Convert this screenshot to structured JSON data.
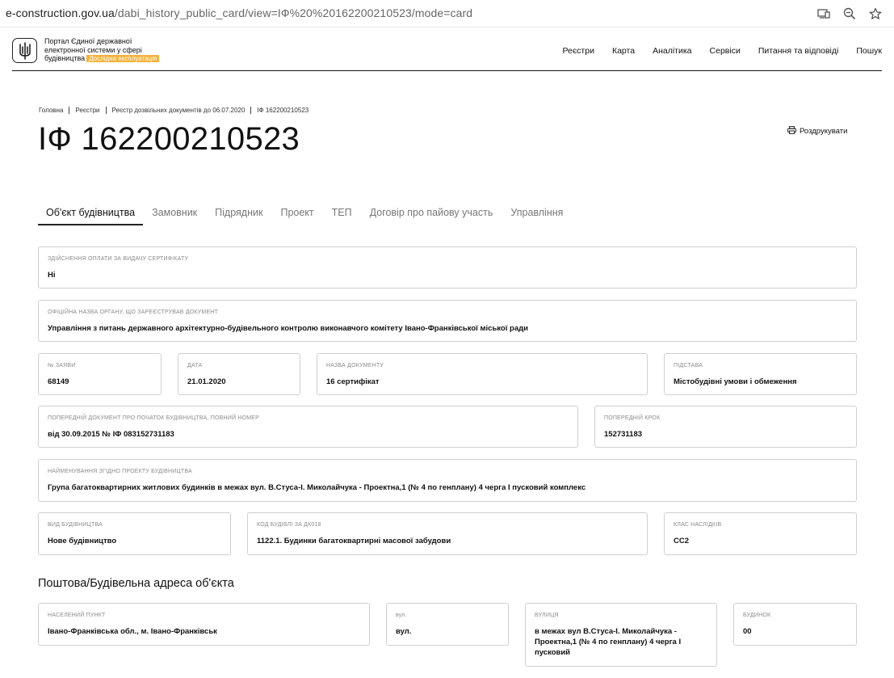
{
  "browser": {
    "url_host": "e-construction.gov.ua",
    "url_path": "/dabi_history_public_card/view=IФ%20%20162200210523/mode=card"
  },
  "header": {
    "logo_line1": "Портал Єдиної державної",
    "logo_line2": "електронної системи у сфері",
    "logo_line3": "будівництва",
    "logo_badge": "Дослідна експлуатація",
    "nav": [
      "Реєстри",
      "Карта",
      "Аналітика",
      "Сервіси",
      "Питання та відповіді",
      "Пошук"
    ]
  },
  "breadcrumb": [
    "Головна",
    "Реєстри",
    "Реєстр дозвільних документів до 06.07.2020",
    "ІФ 162200210523"
  ],
  "page_title": "ІФ 162200210523",
  "print_label": "Роздрукувати",
  "tabs": [
    "Об'єкт будівництва",
    "Замовник",
    "Підрядник",
    "Проект",
    "ТЕП",
    "Договір про пайову участь",
    "Управління"
  ],
  "fields": {
    "payment": {
      "label": "Здійснення оплати за видачу сертифікату",
      "value": "Ні"
    },
    "authority": {
      "label": "Офіційна назва органу, що зареєстрував документ",
      "value": "Управління з питань державного архітектурно-будівельного контролю виконавчого комітету Івано-Франківської міської ради"
    },
    "app_no": {
      "label": "№ заяви",
      "value": "68149"
    },
    "date": {
      "label": "Дата",
      "value": "21.01.2020"
    },
    "doc_name": {
      "label": "Назва документу",
      "value": "16 сертифікат"
    },
    "basis": {
      "label": "Підстава",
      "value": "Містобудівні умови і обмеження"
    },
    "prev_doc": {
      "label": "Попередній документ про початок будівництва, повний номер",
      "value": "від 30.09.2015 № ІФ 083152731183"
    },
    "prev_step": {
      "label": "Попередній крок",
      "value": "152731183"
    },
    "project_name": {
      "label": "Найменування згідно проекту будівництва",
      "value": "Група багатоквартирних житлових будинків в межах вул. В.Стуса-І. Миколайчука - Проектна,1 (№ 4 по генплану) 4 черга І пусковий комплекс"
    },
    "build_type": {
      "label": "Вид будівництва",
      "value": "Нове будівництво"
    },
    "building_code": {
      "label": "Код будівлі за ДК018",
      "value": "1122.1. Будинки багатоквартирні масової забудови"
    },
    "consequence_class": {
      "label": "Клас наслідків",
      "value": "СС2"
    }
  },
  "address_section_title": "Поштова/Будівельна адреса об'єкта",
  "address": {
    "settlement": {
      "label": "Населений пункт",
      "value": "Івано-Франківська обл., м. Івано-Франківськ"
    },
    "street_type": {
      "label": "вул.",
      "value": "вул."
    },
    "street": {
      "label": "Вулиця",
      "value": "в межах вул В.Стуса-І. Миколайчука - Проектна,1 (№ 4 по генплану) 4 черга І пусковий"
    },
    "house": {
      "label": "Будинок",
      "value": "00"
    }
  }
}
